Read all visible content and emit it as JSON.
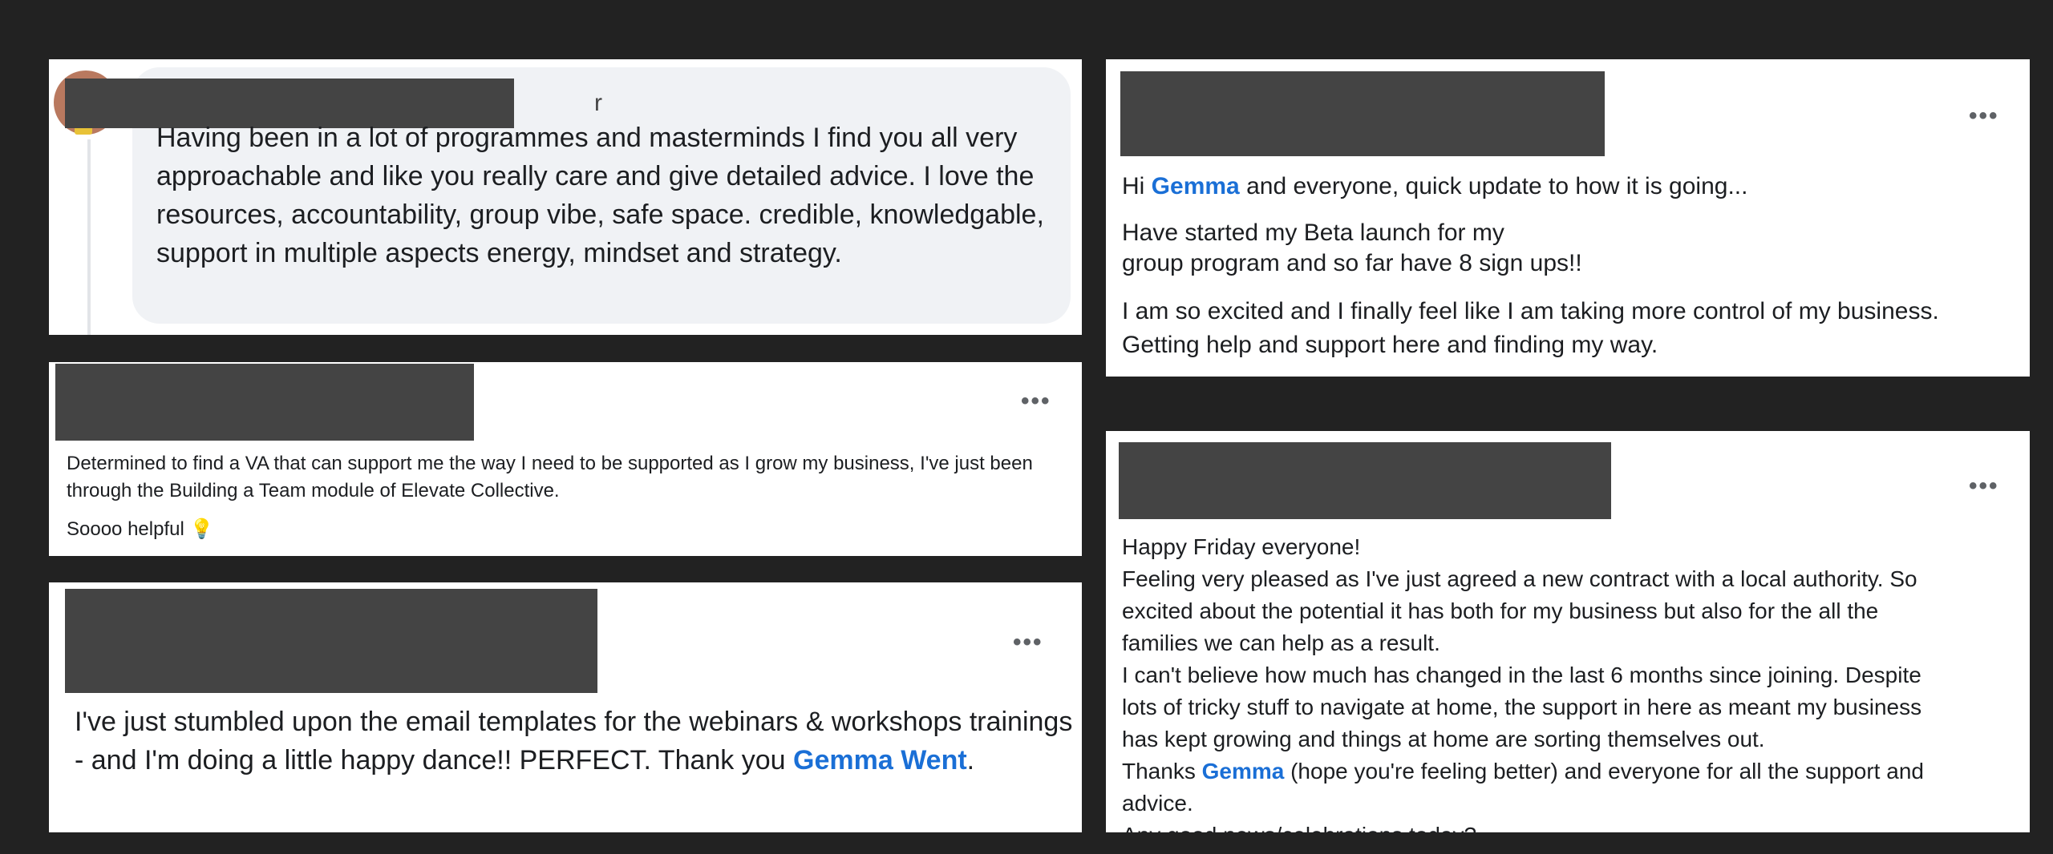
{
  "cards": {
    "card1": {
      "name_tail": "r",
      "text": "Having been in a lot of programmes and masterminds I find you all very approachable and like you really care and give detailed advice. I love the resources, accountability, group vibe, safe space. credible, knowledgable, support in multiple aspects energy, mindset and strategy."
    },
    "card2": {
      "more_label": "•••",
      "text": "Determined to find a VA that can support me the way I need to be supported as I grow my business, I've just been through the Building a Team module of Elevate Collective.",
      "text2": "Soooo helpful",
      "emoji": "💡"
    },
    "card3": {
      "more_label": "•••",
      "text_before": "I've just stumbled upon the email templates for the webinars & workshops trainings - and I'm doing a little happy dance!!  PERFECT.  Thank you ",
      "mention": "Gemma Went",
      "text_after": "."
    },
    "card4": {
      "more_label": "•••",
      "greeting_pre": "Hi ",
      "mention": "Gemma",
      "greeting_post": "  and everyone, quick update to how it is going...",
      "line2": "Have started my Beta launch for my",
      "line3": "group program and so far have 8 sign ups!!",
      "line4": "I am so excited and I finally feel like I am taking more control of my business.",
      "line5": "Getting help and support here and finding my way."
    },
    "card5": {
      "more_label": "•••",
      "line1": "Happy Friday everyone!",
      "line2": "Feeling very pleased as I've just agreed a new contract with a local authority.  So",
      "line3": "excited about the potential it has both for my business but also for the all the",
      "line4": "families we can help as a result.",
      "line5": "I can't believe how much has changed in the last 6 months since joining.  Despite",
      "line6": "lots of tricky stuff to navigate at home, the support in here as meant my business",
      "line7": "has kept growing and things at home are sorting themselves out.",
      "line8_pre": "Thanks ",
      "mention": "Gemma",
      "line8_post": " (hope you're feeling better) and everyone for all the support and",
      "line9": "advice.",
      "line10": "Any good news/celebrations today?"
    }
  }
}
